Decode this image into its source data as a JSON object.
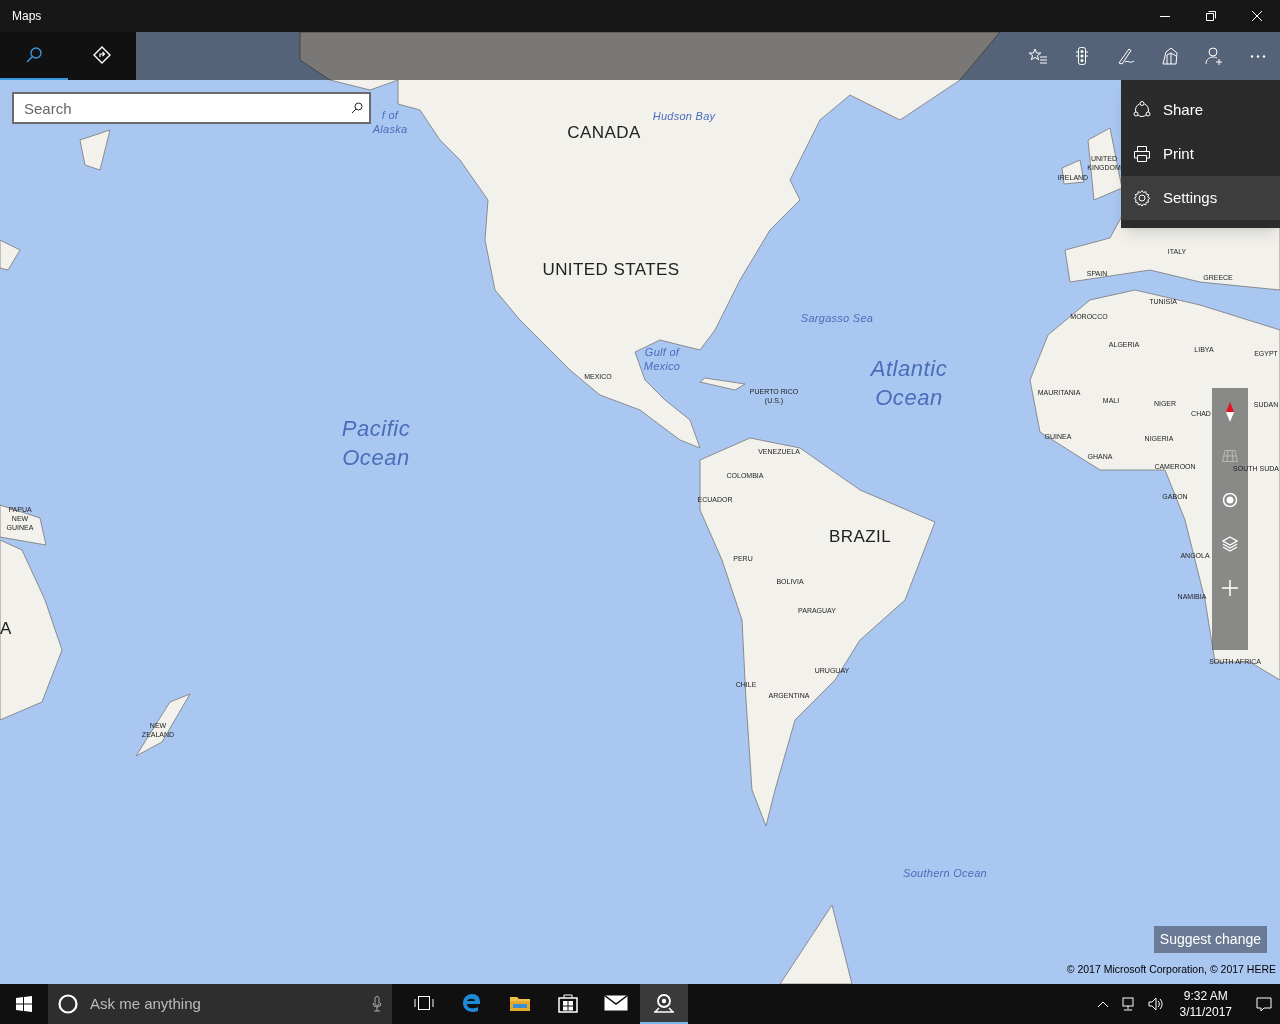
{
  "window": {
    "title": "Maps"
  },
  "app_bar": {
    "tabs": [
      {
        "kind": "search",
        "selected": true
      },
      {
        "kind": "directions",
        "selected": false
      }
    ],
    "actions": [
      {
        "kind": "favorites"
      },
      {
        "kind": "traffic"
      },
      {
        "kind": "ink"
      },
      {
        "kind": "cities"
      },
      {
        "kind": "account"
      },
      {
        "kind": "more"
      }
    ]
  },
  "search": {
    "placeholder": "Search"
  },
  "menu": {
    "items": [
      {
        "kind": "share",
        "label": "Share",
        "selected": false
      },
      {
        "kind": "print",
        "label": "Print",
        "selected": false
      },
      {
        "kind": "settings",
        "label": "Settings",
        "selected": true
      }
    ]
  },
  "map": {
    "labels": [
      {
        "kind": "sea",
        "text": "Hudson Bay"
      },
      {
        "kind": "sea",
        "text": "f of\nAlaska"
      },
      {
        "kind": "large",
        "text": "CANADA"
      },
      {
        "kind": "country",
        "text": "UNITED\nKINGDOM"
      },
      {
        "kind": "country",
        "text": "IRELAND"
      },
      {
        "kind": "country",
        "text": "ITALY"
      },
      {
        "kind": "large",
        "text": "UNITED STATES"
      },
      {
        "kind": "country",
        "text": "SPAIN"
      },
      {
        "kind": "country",
        "text": "GREECE"
      },
      {
        "kind": "country",
        "text": "TUNISIA"
      },
      {
        "kind": "country",
        "text": "MOROCCO"
      },
      {
        "kind": "sea",
        "text": "Sargasso Sea"
      },
      {
        "kind": "country",
        "text": "ALGERIA"
      },
      {
        "kind": "country",
        "text": "LIBYA"
      },
      {
        "kind": "country",
        "text": "EGYPT"
      },
      {
        "kind": "sea",
        "text": "Gulf of\nMexico"
      },
      {
        "kind": "country",
        "text": "MEXICO"
      },
      {
        "kind": "ocean",
        "text": "Atlantic\nOcean"
      },
      {
        "kind": "country",
        "text": "MAURITANIA"
      },
      {
        "kind": "country",
        "text": "PUERTO RICO\n(U.S.)"
      },
      {
        "kind": "country",
        "text": "MALI"
      },
      {
        "kind": "country",
        "text": "NIGER"
      },
      {
        "kind": "country",
        "text": "SUDAN"
      },
      {
        "kind": "country",
        "text": "CHAD"
      },
      {
        "kind": "country",
        "text": "GUINEA"
      },
      {
        "kind": "country",
        "text": "NIGERIA"
      },
      {
        "kind": "ocean",
        "text": "Pacific\nOcean"
      },
      {
        "kind": "country",
        "text": "VENEZUELA"
      },
      {
        "kind": "country",
        "text": "SOUTH SUDA"
      },
      {
        "kind": "country",
        "text": "GHANA"
      },
      {
        "kind": "country",
        "text": "CAMEROON"
      },
      {
        "kind": "country",
        "text": "COLOMBIA"
      },
      {
        "kind": "country",
        "text": "GABON"
      },
      {
        "kind": "country",
        "text": "ECUADOR"
      },
      {
        "kind": "country",
        "text": "PAPUA\nNEW\nGUINEA"
      },
      {
        "kind": "large",
        "text": "BRAZIL"
      },
      {
        "kind": "country",
        "text": "ANGOLA"
      },
      {
        "kind": "country",
        "text": "PERU"
      },
      {
        "kind": "country",
        "text": "BOLIVIA"
      },
      {
        "kind": "country",
        "text": "NAMIBIA"
      },
      {
        "kind": "country",
        "text": "PARAGUAY"
      },
      {
        "kind": "large",
        "text": "A"
      },
      {
        "kind": "country",
        "text": "SOUTH AFRICA"
      },
      {
        "kind": "country",
        "text": "URUGUAY"
      },
      {
        "kind": "country",
        "text": "CHILE"
      },
      {
        "kind": "country",
        "text": "ARGENTINA"
      },
      {
        "kind": "country",
        "text": "NEW\nZEALAND"
      },
      {
        "kind": "sea",
        "text": "Southern Ocean"
      }
    ]
  },
  "map_controls": [
    {
      "kind": "compass",
      "disabled": false
    },
    {
      "kind": "tilt",
      "disabled": true
    },
    {
      "kind": "locate",
      "disabled": false
    },
    {
      "kind": "layers",
      "disabled": false
    },
    {
      "kind": "zoom_in",
      "disabled": false
    }
  ],
  "suggest_button": "Suggest change",
  "copyright": "© 2017 Microsoft Corporation, © 2017 HERE",
  "taskbar": {
    "search_placeholder": "Ask me anything",
    "apps": [
      {
        "kind": "task_view",
        "active": false
      },
      {
        "kind": "browser",
        "active": false
      },
      {
        "kind": "files",
        "active": false
      },
      {
        "kind": "store",
        "active": false
      },
      {
        "kind": "mail",
        "active": false
      },
      {
        "kind": "maps",
        "active": true
      }
    ],
    "time": "9:32 AM",
    "date": "3/11/2017"
  }
}
